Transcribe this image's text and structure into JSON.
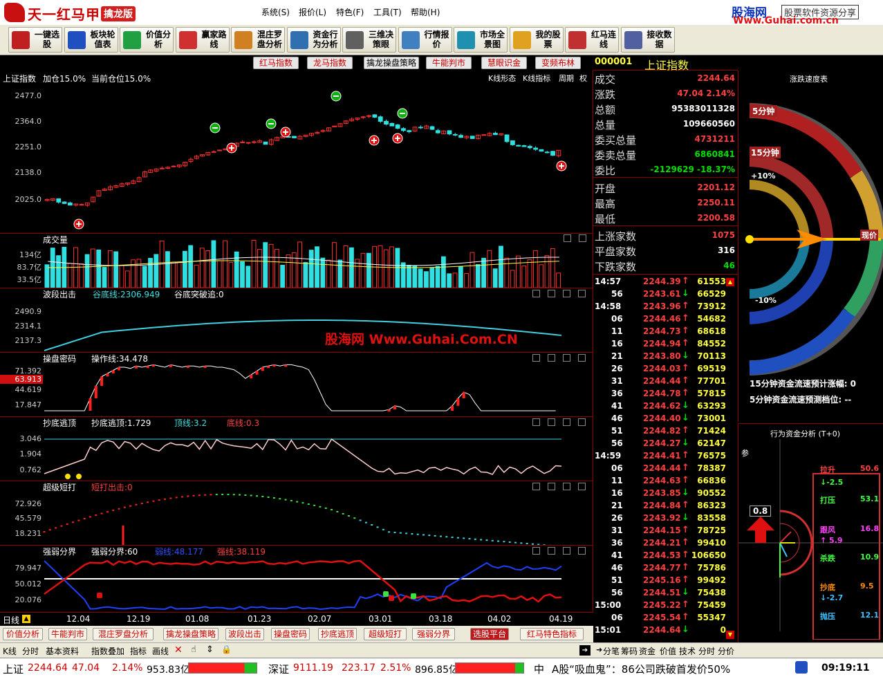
{
  "app": {
    "name": "天一红马甲",
    "edition": "擒龙版"
  },
  "menu": [
    "系统(S)",
    "报价(L)",
    "特色(F)",
    "工具(T)",
    "帮助(H)"
  ],
  "brand": {
    "name": "股海网",
    "tagline": "股票软件资源分享",
    "url": "Www.Guhai.com.cn"
  },
  "toolbar": [
    {
      "label": "一键选股",
      "icon": "one-click-select-icon",
      "color": "#c02020"
    },
    {
      "label": "板块轮值表",
      "icon": "sector-rotation-icon",
      "color": "#2050c0"
    },
    {
      "label": "价值分析",
      "icon": "value-analysis-icon",
      "color": "#20a040"
    },
    {
      "label": "赢家路线",
      "icon": "winner-route-icon",
      "color": "#d03030"
    },
    {
      "label": "混庄罗盘分析",
      "icon": "compass-icon",
      "color": "#d08020"
    },
    {
      "label": "资金行为分析",
      "icon": "fund-behavior-icon",
      "color": "#3070b0"
    },
    {
      "label": "三维决策眼",
      "icon": "gear-icon",
      "color": "#606060"
    },
    {
      "label": "行情报价",
      "icon": "quote-grid-icon",
      "color": "#4080c0"
    },
    {
      "label": "市场全景图",
      "icon": "market-map-icon",
      "color": "#2090b0"
    },
    {
      "label": "我的股票",
      "icon": "star-icon",
      "color": "#e0a020"
    },
    {
      "label": "红马连线",
      "icon": "horse-link-icon",
      "color": "#c03030"
    },
    {
      "label": "接收数据",
      "icon": "receive-data-icon",
      "color": "#5060a0"
    }
  ],
  "tabs": [
    {
      "label": "红马指数",
      "red": true
    },
    {
      "label": "龙马指数",
      "red": true
    },
    {
      "label": "擒龙操盘策略",
      "red": false
    },
    {
      "label": "牛能判市",
      "red": true
    },
    {
      "label": "慧眼识金",
      "red": true
    },
    {
      "label": "变频布林",
      "red": true
    }
  ],
  "main": {
    "index_name": "上证指数",
    "add_pos": "加仓15.0%",
    "cur_pos": "当前仓位15.0%",
    "right_labels": [
      "K线形态",
      "K线指标",
      "周期",
      "权"
    ],
    "yaxis": [
      "2477.0",
      "2364.0",
      "2251.0",
      "2138.0",
      "2025.0"
    ]
  },
  "volume": {
    "title": "成交量",
    "yaxis": [
      "134亿",
      "83.7亿",
      "33.5亿"
    ]
  },
  "wave": {
    "title": "波段出击",
    "l1": "谷底线:2306.949",
    "l2": "谷底突破追:0",
    "yaxis": [
      "2490.9",
      "2314.1",
      "2137.3"
    ]
  },
  "watermark": "股海网 Www.Guhai.Com.CN",
  "ops": {
    "title": "操盘密码",
    "l1": "操作线:34.478",
    "yaxis": [
      "71.392",
      "44.619",
      "17.847"
    ],
    "marker": "63.913"
  },
  "bottom": {
    "title": "抄底逃顶",
    "l1": "抄底逃顶:1.729",
    "l2": "顶线:3.2",
    "l3": "底线:0.3",
    "yaxis": [
      "3.046",
      "1.904",
      "0.762"
    ]
  },
  "super": {
    "title": "超级短打",
    "l1": "短打出击:0",
    "yaxis": [
      "72.926",
      "45.579",
      "18.231"
    ]
  },
  "strength": {
    "title": "强弱分界",
    "l1": "强弱分界:60",
    "l2": "弱线:48.177",
    "l3": "强线:38.119",
    "yaxis": [
      "79.947",
      "50.012",
      "20.076"
    ]
  },
  "xaxis": {
    "period": "日线",
    "dates": [
      "12.04",
      "12.19",
      "01.08",
      "01.23",
      "02.07",
      "03.01",
      "03.18",
      "04.02",
      "04.19"
    ]
  },
  "bottom_tabs": [
    "价值分析",
    "牛能判市",
    "混庄罗盘分析",
    "擒龙操盘策略",
    "波段出击",
    "操盘密码",
    "抄底逃顶",
    "超级短打",
    "强弱分界",
    "选股平台",
    "红马特色指标"
  ],
  "bottom_tools": [
    "K线",
    "分时",
    "基本资料",
    "指数叠加",
    "指标",
    "画线"
  ],
  "right_tools": [
    "分笔",
    "筹码",
    "资金",
    "价值",
    "技术",
    "分时",
    "分价"
  ],
  "quote": {
    "code": "000001",
    "name": "上证指数",
    "rows": [
      {
        "label": "成交",
        "value": "2244.64",
        "cls": "up"
      },
      {
        "label": "涨跌",
        "value": "47.04  2.14%",
        "cls": "up"
      },
      {
        "label": "总额",
        "value": "95383011328",
        "cls": "white"
      },
      {
        "label": "总量",
        "value": "109660560",
        "cls": "white"
      },
      {
        "label": "委买总量",
        "value": "4731211",
        "cls": "up"
      },
      {
        "label": "委卖总量",
        "value": "6860841",
        "cls": "down"
      },
      {
        "label": "委比",
        "value": "-2129629 -18.37%",
        "cls": "down"
      },
      {
        "label": "开盘",
        "value": "2201.12",
        "cls": "up"
      },
      {
        "label": "最高",
        "value": "2250.11",
        "cls": "up"
      },
      {
        "label": "最低",
        "value": "2200.58",
        "cls": "up"
      },
      {
        "label": "上涨家数",
        "value": "1075",
        "cls": "up"
      },
      {
        "label": "平盘家数",
        "value": "316",
        "cls": "white"
      },
      {
        "label": "下跌家数",
        "value": "46",
        "cls": "down"
      }
    ],
    "ticks": [
      {
        "t": "14:57",
        "p": "2244.39",
        "d": "up",
        "v": "61553"
      },
      {
        "t": "56",
        "p": "2243.61",
        "d": "down",
        "v": "66529"
      },
      {
        "t": "14:58",
        "p": "2243.96",
        "d": "up",
        "v": "73912"
      },
      {
        "t": "06",
        "p": "2244.46",
        "d": "up",
        "v": "54682"
      },
      {
        "t": "11",
        "p": "2244.73",
        "d": "up",
        "v": "68618"
      },
      {
        "t": "16",
        "p": "2244.94",
        "d": "up",
        "v": "84552"
      },
      {
        "t": "21",
        "p": "2243.80",
        "d": "down",
        "v": "70113"
      },
      {
        "t": "26",
        "p": "2244.03",
        "d": "up",
        "v": "69519"
      },
      {
        "t": "31",
        "p": "2244.44",
        "d": "up",
        "v": "77701"
      },
      {
        "t": "36",
        "p": "2244.78",
        "d": "up",
        "v": "57815"
      },
      {
        "t": "41",
        "p": "2244.62",
        "d": "down",
        "v": "63293"
      },
      {
        "t": "46",
        "p": "2244.40",
        "d": "down",
        "v": "73001"
      },
      {
        "t": "51",
        "p": "2244.82",
        "d": "up",
        "v": "71424"
      },
      {
        "t": "56",
        "p": "2244.27",
        "d": "down",
        "v": "62147"
      },
      {
        "t": "14:59",
        "p": "2244.41",
        "d": "up",
        "v": "76575"
      },
      {
        "t": "06",
        "p": "2244.44",
        "d": "up",
        "v": "78387"
      },
      {
        "t": "11",
        "p": "2244.63",
        "d": "up",
        "v": "66836"
      },
      {
        "t": "16",
        "p": "2243.85",
        "d": "down",
        "v": "90552"
      },
      {
        "t": "21",
        "p": "2244.84",
        "d": "up",
        "v": "86323"
      },
      {
        "t": "26",
        "p": "2243.92",
        "d": "down",
        "v": "83558"
      },
      {
        "t": "31",
        "p": "2244.15",
        "d": "up",
        "v": "78725"
      },
      {
        "t": "36",
        "p": "2244.21",
        "d": "up",
        "v": "99410"
      },
      {
        "t": "41",
        "p": "2244.53",
        "d": "up",
        "v": "106650"
      },
      {
        "t": "46",
        "p": "2244.77",
        "d": "up",
        "v": "75786"
      },
      {
        "t": "51",
        "p": "2245.16",
        "d": "up",
        "v": "99492"
      },
      {
        "t": "56",
        "p": "2244.51",
        "d": "down",
        "v": "75438"
      },
      {
        "t": "15:00",
        "p": "2245.22",
        "d": "up",
        "v": "75459"
      },
      {
        "t": "06",
        "p": "2245.54",
        "d": "up",
        "v": "55347"
      },
      {
        "t": "15:01",
        "p": "2244.64",
        "d": "down",
        "v": "0"
      }
    ]
  },
  "speed": {
    "title": "涨跌速度表",
    "g5": "5分钟",
    "g15": "15分钟",
    "plus": "+10%",
    "minus": "-10%",
    "now": "现价",
    "line1": "15分钟资金流速预计涨幅: 0",
    "line2": "5分钟资金流速预测档位: --"
  },
  "fund": {
    "title": "行为资金分析 (T+0)",
    "ref": "参",
    "gauge": "0.8",
    "items": [
      {
        "label": "拉升",
        "value": "50.6"
      },
      {
        "label": "↓-2.5",
        "value": ""
      },
      {
        "label": "打压",
        "value": "53.1"
      },
      {
        "label": "跟风",
        "value": "16.8"
      },
      {
        "label": "↑ 5.9",
        "value": ""
      },
      {
        "label": "杀跌",
        "value": "10.9"
      },
      {
        "label": "抄底",
        "value": "9.5"
      },
      {
        "label": "↓-2.7",
        "value": ""
      },
      {
        "label": "抛压",
        "value": "12.1"
      }
    ]
  },
  "status": {
    "sh_label": "上证",
    "sh": "2244.64",
    "sh_chg": "47.04",
    "sh_pct": "2.14%",
    "sh_amt": "953.83亿",
    "sz_label": "深证",
    "sz": "9111.19",
    "sz_chg": "223.17",
    "sz_pct": "2.51%",
    "sz_amt": "896.85亿",
    "mid": "中",
    "news": "A股“吸血鬼”：86公司跌破首发价50%",
    "time": "09:19:11"
  }
}
